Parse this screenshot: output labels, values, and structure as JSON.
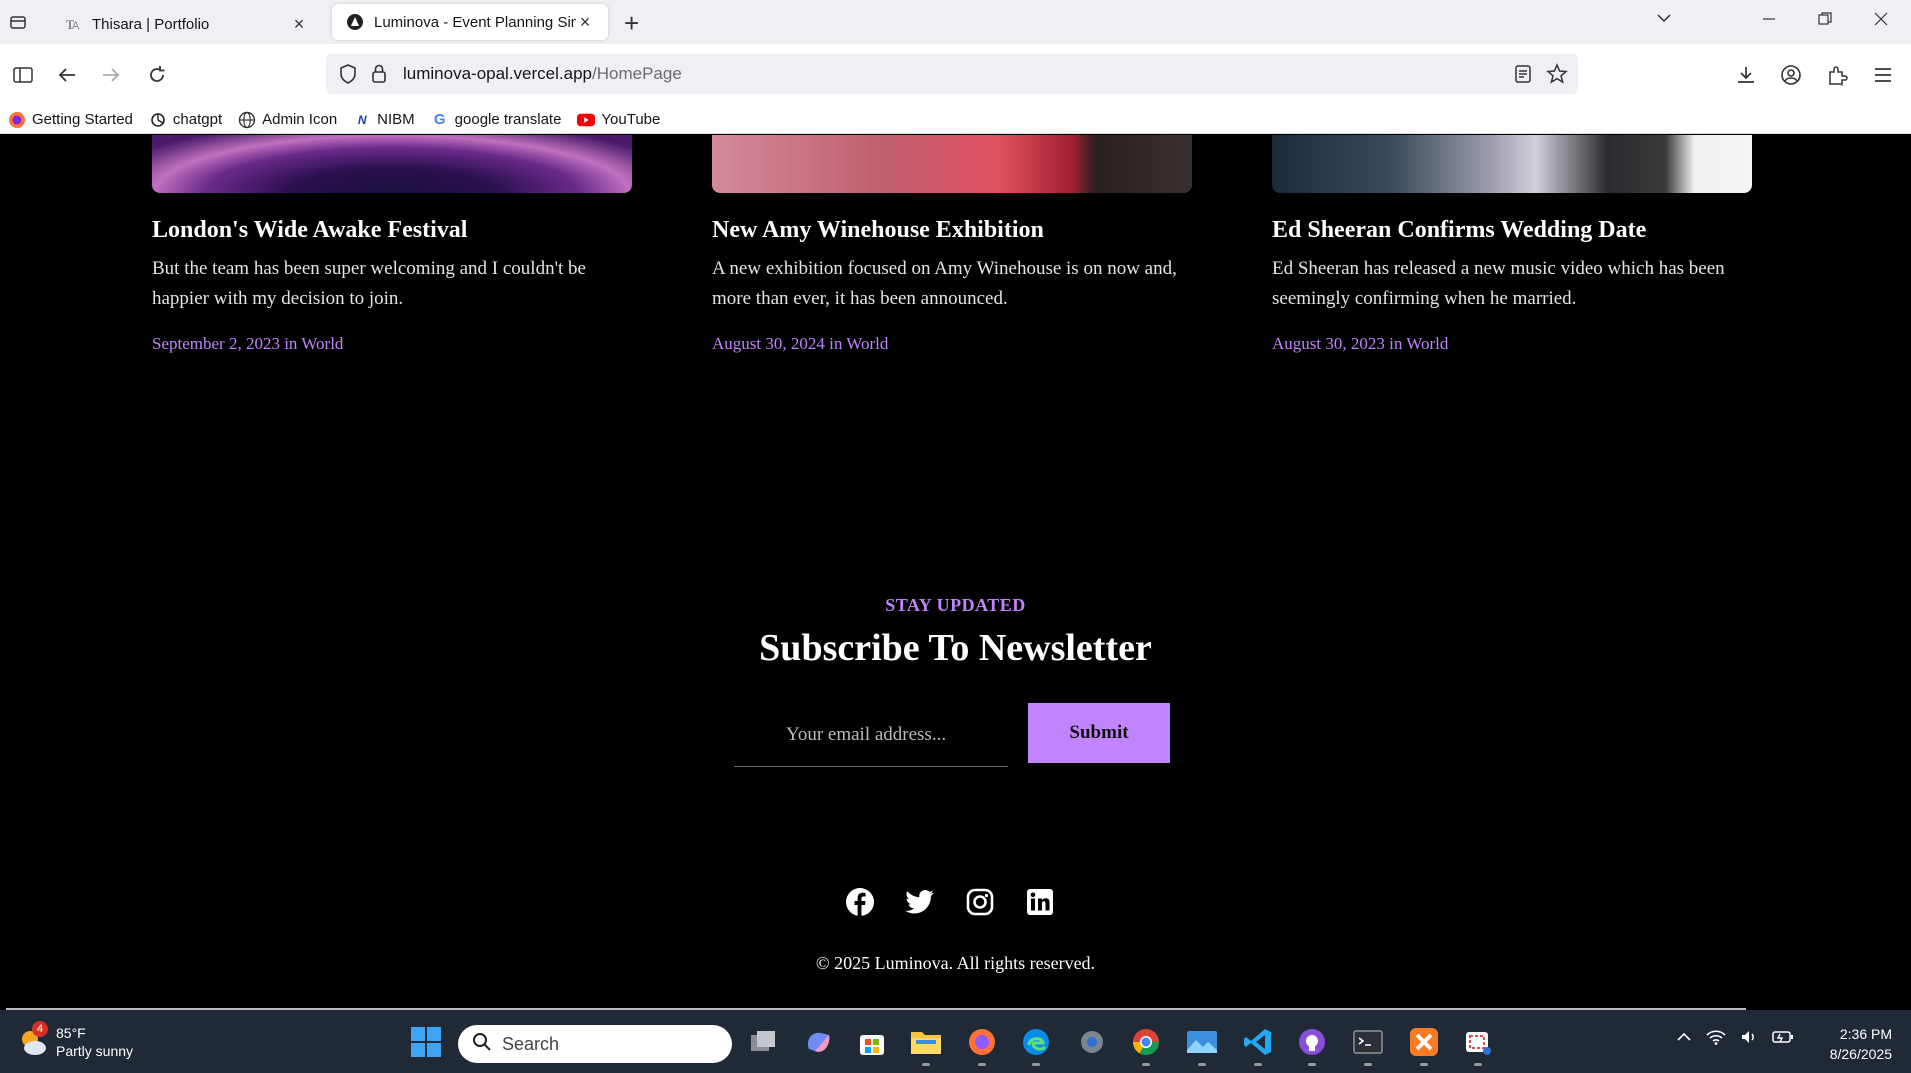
{
  "browser": {
    "tabs": [
      {
        "title": "Thisara | Portfolio",
        "active": false
      },
      {
        "title": "Luminova - Event Planning Simp",
        "active": true
      }
    ],
    "url_host": "luminova-opal.vercel.app",
    "url_path": "/HomePage",
    "bookmarks": [
      {
        "label": "Getting Started",
        "icon": "firefox-icon"
      },
      {
        "label": "chatgpt",
        "icon": "openai-icon"
      },
      {
        "label": "Admin Icon",
        "icon": "globe-icon"
      },
      {
        "label": "NIBM",
        "icon": "nibm-icon"
      },
      {
        "label": "google translate",
        "icon": "google-icon"
      },
      {
        "label": "YouTube",
        "icon": "youtube-icon"
      }
    ]
  },
  "articles": [
    {
      "title": "London's Wide Awake Festival",
      "excerpt": "But the team has been super welcoming and I couldn't be happier with my decision to join.",
      "date": "September 2, 2023",
      "category": "World",
      "meta": "September 2, 2023 in World"
    },
    {
      "title": "New Amy Winehouse Exhibition",
      "excerpt": "A new exhibition focused on Amy Winehouse is on now and, more than ever, it has been announced.",
      "date": "August 30, 2024",
      "category": "World",
      "meta": "August 30, 2024 in World"
    },
    {
      "title": "Ed Sheeran Confirms Wedding Date",
      "excerpt": "Ed Sheeran has released a new music video which has been seemingly confirming when he married.",
      "date": "August 30, 2023",
      "category": "World",
      "meta": "August 30, 2023 in World"
    }
  ],
  "newsletter": {
    "eyebrow": "STAY UPDATED",
    "heading": "Subscribe To Newsletter",
    "email_placeholder": "Your email address...",
    "submit_label": "Submit"
  },
  "footer": {
    "social": [
      "facebook-icon",
      "twitter-icon",
      "instagram-icon",
      "linkedin-icon"
    ],
    "copyright": "© 2025 Luminova. All rights reserved."
  },
  "taskbar": {
    "weather_temp": "85°F",
    "weather_desc": "Partly sunny",
    "weather_badge": "4",
    "search_label": "Search",
    "time": "2:36 PM",
    "date": "8/26/2025"
  },
  "colors": {
    "accent": "#c084fc",
    "page_bg": "#000000"
  }
}
